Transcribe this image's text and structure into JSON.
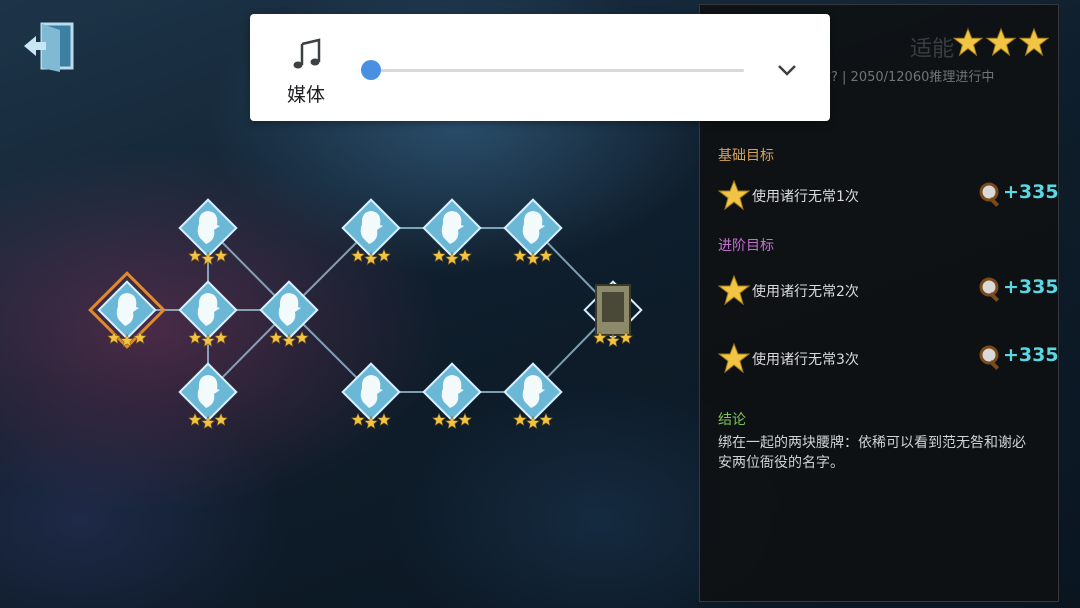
{
  "exit": {
    "icon": "exit-door-icon"
  },
  "media_overlay": {
    "icon": "music-note-icon",
    "label": "媒体",
    "volume_fraction": 0.0,
    "expand_icon": "chevron-down-icon",
    "accent_color": "#4a90e2"
  },
  "panel": {
    "title_partial": "适能",
    "rating_stars": 3,
    "subtitle_partial": "加故? | 2050/12060推理进行中",
    "sections": {
      "basic": {
        "heading": "基础目标",
        "color": "#d7a35a"
      },
      "advanced": {
        "heading": "进阶目标",
        "color": "#c36fd0"
      },
      "conclusion": {
        "heading": "结论",
        "color": "#7cc25a"
      }
    },
    "goals": [
      {
        "text": "使用诸行无常1次",
        "reward": "+335",
        "icon": "magnifier-icon"
      },
      {
        "text": "使用诸行无常2次",
        "reward": "+335",
        "icon": "magnifier-icon"
      },
      {
        "text": "使用诸行无常3次",
        "reward": "+335",
        "icon": "magnifier-icon"
      }
    ],
    "conclusion_text": "绑在一起的两块腰牌：依稀可以看到范无咎和谢必安两位衙役的名字。"
  },
  "map": {
    "nodes": [
      {
        "id": "n0",
        "type": "detective",
        "stars": 3,
        "selected": true
      },
      {
        "id": "n1",
        "type": "detective",
        "stars": 3
      },
      {
        "id": "n2",
        "type": "detective",
        "stars": 3
      },
      {
        "id": "n3",
        "type": "detective",
        "stars": 3
      },
      {
        "id": "n4",
        "type": "detective",
        "stars": 3
      },
      {
        "id": "n5",
        "type": "detective",
        "stars": 3
      },
      {
        "id": "n6",
        "type": "detective",
        "stars": 3
      },
      {
        "id": "n7",
        "type": "detective",
        "stars": 3
      },
      {
        "id": "n8",
        "type": "detective",
        "stars": 3
      },
      {
        "id": "n9",
        "type": "detective",
        "stars": 3
      },
      {
        "id": "n10",
        "type": "detective",
        "stars": 3
      },
      {
        "id": "n11",
        "type": "item-card",
        "stars": 3
      }
    ],
    "edges": [
      [
        "n0",
        "n2"
      ],
      [
        "n1",
        "n2"
      ],
      [
        "n2",
        "n3"
      ],
      [
        "n1",
        "n4"
      ],
      [
        "n2",
        "n4"
      ],
      [
        "n3",
        "n4"
      ],
      [
        "n4",
        "n5"
      ],
      [
        "n5",
        "n6"
      ],
      [
        "n6",
        "n7"
      ],
      [
        "n7",
        "n11"
      ],
      [
        "n4",
        "n8"
      ],
      [
        "n8",
        "n9"
      ],
      [
        "n9",
        "n10"
      ],
      [
        "n10",
        "n11"
      ]
    ],
    "colors": {
      "node_fill": "#6ab7d6",
      "node_border": "#d7f0ff",
      "selected_border": "#e08a2c",
      "star": "#f2c443",
      "edge": "#a9d6ea"
    }
  }
}
